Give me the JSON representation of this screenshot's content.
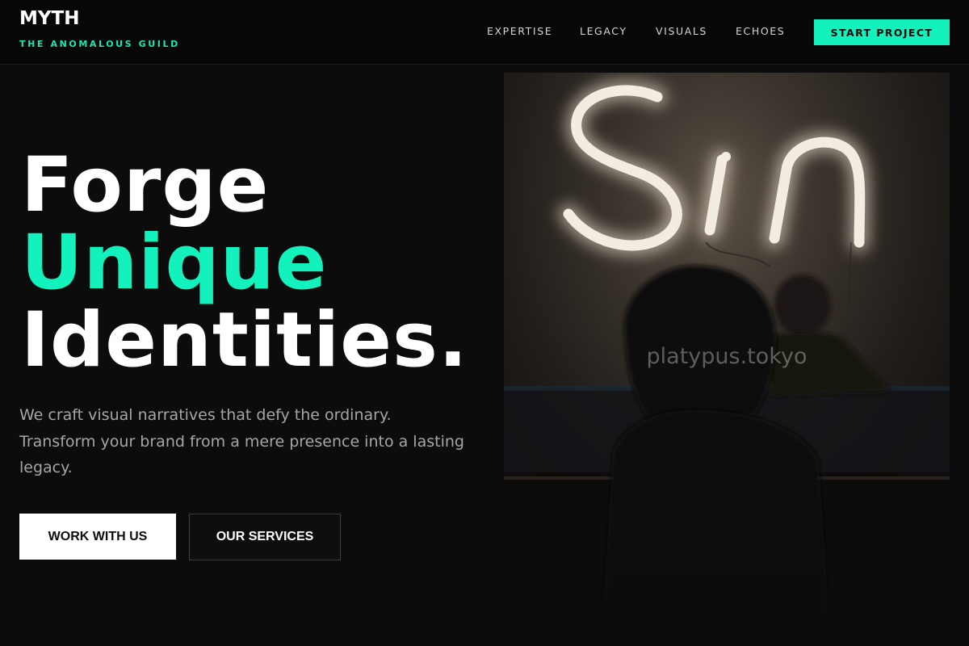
{
  "brand": {
    "name": "MYTH",
    "tagline": "THE ANOMALOUS GUILD"
  },
  "nav": {
    "items": [
      {
        "label": "EXPERTISE"
      },
      {
        "label": "LEGACY"
      },
      {
        "label": "VISUALS"
      },
      {
        "label": "ECHOES"
      }
    ],
    "cta_label": "START PROJECT"
  },
  "hero": {
    "title_line1": "Forge",
    "title_line2": "Unique",
    "title_line3": "Identities.",
    "description": "We craft visual narratives that defy the ordinary. Transform your brand from a mere presence into a lasting legacy.",
    "primary_button": "WORK WITH US",
    "secondary_button": "OUR SERVICES",
    "image": {
      "watermark": "platypus.tokyo",
      "neon_sign_text": "Sin"
    }
  },
  "colors": {
    "accent": "#13f2bd",
    "background": "#0c0c0c",
    "header_background": "#070707",
    "text_primary": "#ffffff",
    "text_muted": "#a6a6a6"
  }
}
